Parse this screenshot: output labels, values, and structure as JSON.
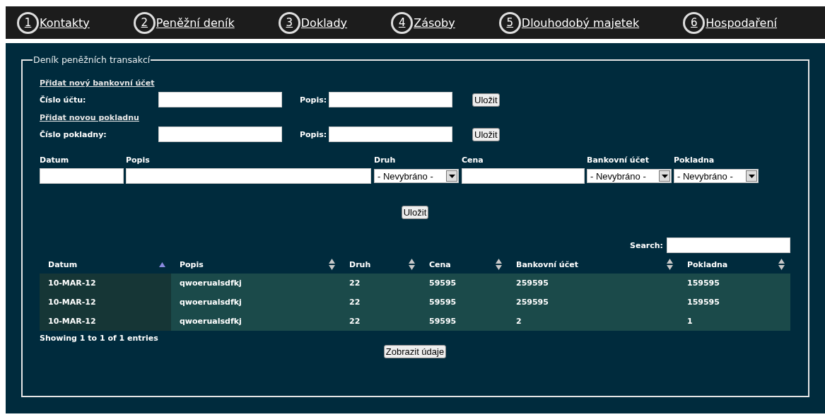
{
  "nav": [
    {
      "number": "1",
      "label": "Kontakty"
    },
    {
      "number": "2",
      "label": "Peněžní deník"
    },
    {
      "number": "3",
      "label": "Doklady"
    },
    {
      "number": "4",
      "label": "Zásoby"
    },
    {
      "number": "5",
      "label": "Dlouhodobý majetek"
    },
    {
      "number": "6",
      "label": "Hospodaření"
    }
  ],
  "fieldset": {
    "legend": "Deník peněžních transakcí",
    "quick_forms": [
      {
        "link": "Přidat nový bankovní účet",
        "label": "Číslo účtu:",
        "description_label": "Popis:",
        "button": "Uložit"
      },
      {
        "link": "Přidat novou pokladnu",
        "label": "Číslo pokladny:",
        "description_label": "Popis:",
        "button": "Uložit"
      }
    ],
    "entry_fields": [
      {
        "label": "Datum",
        "kind": "text"
      },
      {
        "label": "Popis",
        "kind": "text"
      },
      {
        "label": "Druh",
        "kind": "select",
        "value": "- Nevybráno -"
      },
      {
        "label": "Cena",
        "kind": "text"
      },
      {
        "label": "Bankovní účet",
        "kind": "select",
        "value": "- Nevybráno -"
      },
      {
        "label": "Pokladna",
        "kind": "select",
        "value": "- Nevybráno -"
      }
    ],
    "save_button": "Uložit",
    "search_label": "Search:",
    "table": {
      "columns": [
        {
          "label": "Datum",
          "sorted": true
        },
        {
          "label": "Popis",
          "sorted": false
        },
        {
          "label": "Druh",
          "sorted": false
        },
        {
          "label": "Cena",
          "sorted": false
        },
        {
          "label": "Bankovní účet",
          "sorted": false
        },
        {
          "label": "Pokladna",
          "sorted": false
        }
      ],
      "rows": [
        [
          "10-MAR-12",
          "qwoerualsdfkj",
          "22",
          "59595",
          "259595",
          "159595"
        ],
        [
          "10-MAR-12",
          "qwoerualsdfkj",
          "22",
          "59595",
          "259595",
          "159595"
        ],
        [
          "10-MAR-12",
          "qwoerualsdfkj",
          "22",
          "59595",
          "2",
          "1"
        ]
      ]
    },
    "info": "Showing 1 to 1 of 1 entries",
    "show_button": "Zobrazit údaje"
  }
}
